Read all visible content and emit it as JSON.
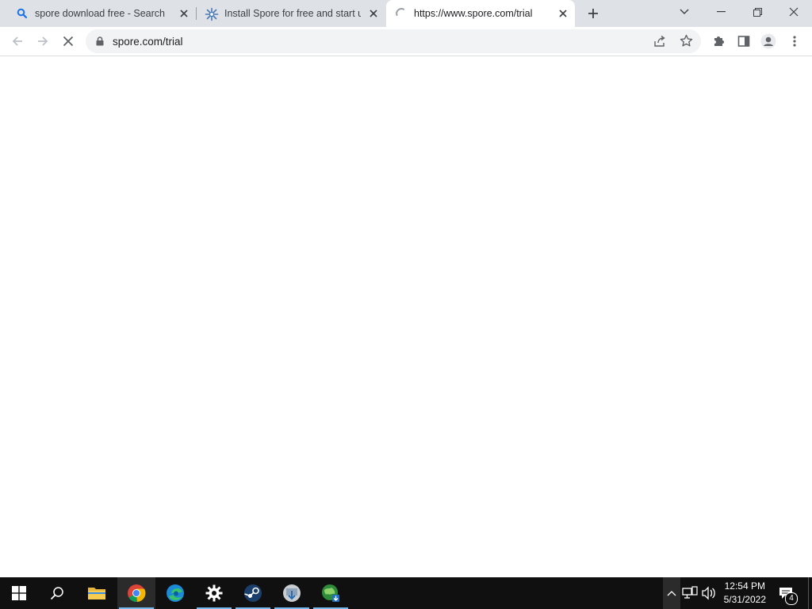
{
  "browser": {
    "tabs": [
      {
        "title": "spore download free - Search",
        "favicon": "search-icon",
        "active": false
      },
      {
        "title": "Install Spore for free and start us",
        "favicon": "spore-favicon-icon",
        "active": false
      },
      {
        "title": "https://www.spore.com/trial",
        "favicon": "loading-spinner-icon",
        "active": true
      }
    ],
    "new_tab_label": "+",
    "address": {
      "url": "spore.com/trial"
    }
  },
  "taskbar": {
    "apps": [
      "start-icon",
      "search-icon",
      "file-explorer-icon",
      "chrome-icon",
      "edge-icon",
      "settings-icon",
      "steam-icon",
      "installer-icon",
      "ea-downloader-icon"
    ],
    "clock": {
      "time": "12:54 PM",
      "date": "5/31/2022"
    },
    "notifications_count": "4"
  },
  "colors": {
    "tabstrip": "#dee1e6",
    "taskbar": "#101010",
    "accent": "#76b9ed"
  }
}
